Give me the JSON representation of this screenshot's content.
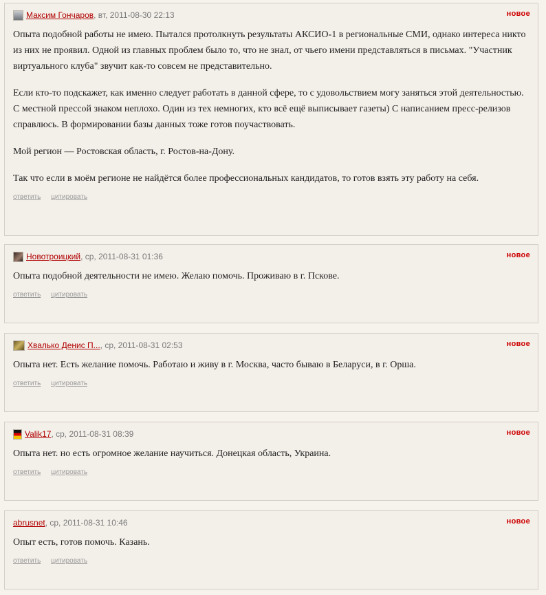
{
  "comments": [
    {
      "author": "Максим Гончаров",
      "meta": ", вт, 2011-08-30 22:13",
      "badge": "новое",
      "avatar_color": "#8a8f96",
      "paragraphs": [
        "Опыта подобной работы не имею. Пытался протолкнуть результаты АКСИО-1 в региональные СМИ, однако интереса никто из них не проявил. Одной из главных проблем было то, что не знал, от чьего имени представляться в письмах. \"Участник виртуального клуба\" звучит как-то совсем не представительно.",
        "Если кто-то подскажет, как именно следует работать в данной сфере, то с удовольствием могу заняться этой деятельностью. С местной прессой знаком неплохо. Один из тех немногих, кто всё ещё выписывает газеты) С написанием пресс-релизов справлюсь. В формировании базы данных тоже готов поучаствовать.",
        "Мой регион — Ростовская область, г. Ростов-на-Дону.",
        "Так что если в моём регионе не найдётся более профессиональных кандидатов, то готов взять эту работу на себя."
      ],
      "reply": "ответить",
      "quote": "цитировать"
    },
    {
      "author": "Новотроицкий",
      "meta": ", ср, 2011-08-31 01:36",
      "badge": "новое",
      "avatar_color": "#5a4a44",
      "paragraphs": [
        "Опыта подобной деятельности не имею. Желаю помочь. Проживаю в г. Пскове."
      ],
      "reply": "ответить",
      "quote": "цитировать"
    },
    {
      "author": "Хвалько Денис П...",
      "meta": ", ср, 2011-08-31 02:53",
      "badge": "новое",
      "avatar_color": "#a08a3c",
      "paragraphs": [
        "Опыта нет. Есть желание помочь. Работаю и живу в г. Москва, часто бываю в Беларуси, в г. Орша."
      ],
      "reply": "ответить",
      "quote": "цитировать"
    },
    {
      "author": "Valik17",
      "meta": ", ср, 2011-08-31 08:39",
      "badge": "новое",
      "avatar_color": "#d6a400",
      "paragraphs": [
        "Опыта нет. но есть огромное желание научиться. Донецкая область, Украина."
      ],
      "reply": "ответить",
      "quote": "цитировать"
    },
    {
      "author": "abrusnet",
      "meta": ", ср, 2011-08-31 10:46",
      "badge": "новое",
      "avatar_color": null,
      "paragraphs": [
        "Опыт есть, готов помочь. Казань."
      ],
      "reply": "ответить",
      "quote": "цитировать"
    }
  ]
}
